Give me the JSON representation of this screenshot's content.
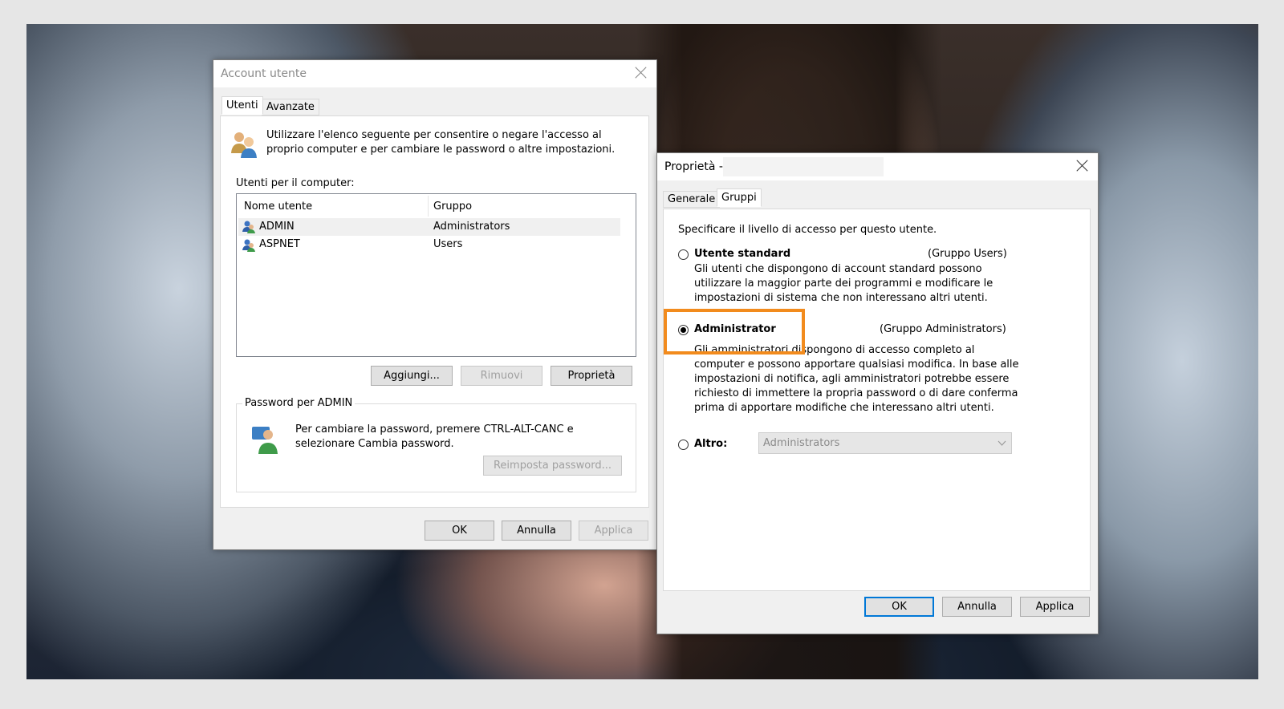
{
  "accounts_dialog": {
    "title": "Account utente",
    "tabs": [
      {
        "label": "Utenti"
      },
      {
        "label": "Avanzate"
      }
    ],
    "intro_line1": "Utilizzare l'elenco seguente per consentire o negare l'accesso al",
    "intro_line2": "proprio computer e per cambiare le password o altre impostazioni.",
    "users_label": "Utenti per il computer:",
    "columns": {
      "name": "Nome utente",
      "group": "Gruppo"
    },
    "rows": [
      {
        "name": "ADMIN",
        "group": "Administrators"
      },
      {
        "name": "ASPNET",
        "group": "Users"
      }
    ],
    "add_button": "Aggiungi...",
    "remove_button": "Rimuovi",
    "properties_button": "Proprietà",
    "password_group_label": "Password per ADMIN",
    "password_line1": "Per cambiare la password, premere CTRL-ALT-CANC e",
    "password_line2": "selezionare Cambia password.",
    "reset_password_button": "Reimposta password...",
    "ok": "OK",
    "cancel": "Annulla",
    "apply": "Applica"
  },
  "properties_dialog": {
    "title": "Proprietà -",
    "tabs": [
      {
        "label": "Generale"
      },
      {
        "label": "Gruppi"
      }
    ],
    "intro": "Specificare il livello di accesso per questo utente.",
    "standard_label": "Utente standard",
    "standard_group": "(Gruppo Users)",
    "standard_desc": [
      "Gli utenti che dispongono di account standard possono",
      "utilizzare la maggior parte dei programmi e modificare le",
      "impostazioni di sistema che non interessano altri utenti."
    ],
    "admin_label": "Administrator",
    "admin_group": "(Gruppo Administrators)",
    "admin_desc": [
      "Gli amministratori dispongono di accesso completo al",
      "computer e possono apportare qualsiasi modifica. In base alle",
      "impostazioni di notifica, agli amministratori potrebbe essere",
      "richiesto di immettere la propria password o di dare conferma",
      "prima di apportare modifiche che interessano altri utenti."
    ],
    "other_label": "Altro:",
    "other_value": "Administrators",
    "selected_option": "Administrator",
    "ok": "OK",
    "cancel": "Annulla",
    "apply": "Applica"
  },
  "colors": {
    "highlight": "#f28b1d",
    "accent": "#0078d7"
  }
}
